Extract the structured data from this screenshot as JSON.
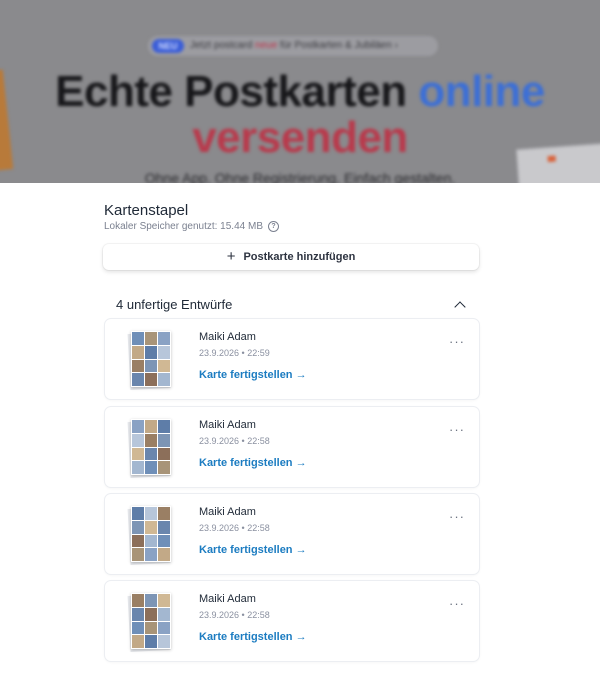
{
  "hero": {
    "badge": "NEU",
    "announce_prefix": "Jetzt postcard ",
    "announce_highlight": "neue",
    "announce_suffix": " für Postkarten & Jubiläen ›",
    "headline_line1_a": "Echte Postkarten ",
    "headline_line1_b": "online",
    "headline_line2": "versenden",
    "subline": "Ohne App. Ohne Registrierung. Einfach gestalten."
  },
  "panel": {
    "title": "Kartenstapel",
    "storage_text": "Lokaler Speicher genutzt: 15.44 MB",
    "help_icon": "?",
    "add_button_icon": "+",
    "add_button_label": "Postkarte hinzufügen",
    "drafts_heading": "4 unfertige Entwürfe"
  },
  "drafts": [
    {
      "name": "Maiki Adam",
      "date": "23.9.2026 • 22:59",
      "cta": "Karte fertigstellen →",
      "menu": "···"
    },
    {
      "name": "Maiki Adam",
      "date": "23.9.2026 • 22:58",
      "cta": "Karte fertigstellen →",
      "menu": "···"
    },
    {
      "name": "Maiki Adam",
      "date": "23.9.2026 • 22:58",
      "cta": "Karte fertigstellen →",
      "menu": "···"
    },
    {
      "name": "Maiki Adam",
      "date": "23.9.2026 • 22:58",
      "cta": "Karte fertigstellen →",
      "menu": "···"
    }
  ],
  "colors": {
    "accent_link": "#1c7cc1",
    "text_primary": "#1f2937",
    "text_muted": "#8a90a0",
    "photo_tones": [
      "#6f8fb8",
      "#a89478",
      "#8aa2c4",
      "#c2a987",
      "#5e7da8",
      "#b7c6da",
      "#9a7f64",
      "#7d95b5",
      "#d0b894",
      "#6a86ad",
      "#8c6f5a",
      "#a3b7d0"
    ]
  },
  "icons": {
    "add": "plus-icon",
    "help": "help-circle-icon",
    "collapse": "chevron-up-icon",
    "menu": "more-horizontal-icon"
  }
}
